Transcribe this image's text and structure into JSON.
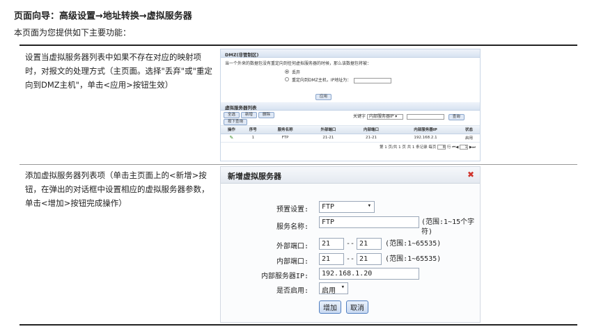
{
  "page": {
    "heading": "页面向导：高级设置→地址转换→虚拟服务器",
    "subheading": "本页面为您提供如下主要功能："
  },
  "rows": [
    {
      "description": "设置当虚拟服务器列表中如果不存在对应的映射项时，对报文的处理方式（主页面。选择\"丢弃\"或\"重定向到DMZ主机\"，单击<应用>按钮生效）"
    },
    {
      "description": "添加虚拟服务器列表项（单击主页面上的<新增>按钮，在弹出的对话框中设置相应的虚拟服务器参数，单击<增加>按钮完成操作）"
    }
  ],
  "dmz_panel": {
    "title": "DMZ(非管制区)",
    "question": "当一个外来的数据包没有重定向到任何虚拟服务器的时候，那么该数据包将被：",
    "option_drop": "丢弃",
    "option_redirect": "重定向到DMZ主机，IP地址为：",
    "apply_label": "应用"
  },
  "vs_list": {
    "title": "虚拟服务器列表",
    "btn_select_all": "全选",
    "btn_add": "新增",
    "btn_delete": "删除",
    "btn_filter": "按下查询",
    "keyword_label": "关键字",
    "keyword_select": "内部服务器IP",
    "search_label": "查询",
    "columns": [
      "操作",
      "序号",
      "服务名称",
      "外部端口",
      "内部端口",
      "内部服务器IP",
      "状态"
    ],
    "row": [
      "1",
      "FTP",
      "21-21",
      "21-21",
      "192.168.2.1",
      "启用"
    ],
    "pager": "第 1 页/共 1 页 共 1 条记录 每页",
    "per_page": "8",
    "pager_mid": "行",
    "page_num": "1"
  },
  "dialog": {
    "title": "新增虚拟服务器",
    "preset_label": "预置设置:",
    "preset_value": "FTP",
    "name_label": "服务名称:",
    "name_value": "FTP",
    "name_range": "(范围:1~15个字符)",
    "ext_port_label": "外部端口:",
    "ext_port_from": "21",
    "ext_port_to": "21",
    "int_port_label": "内部端口:",
    "int_port_from": "21",
    "int_port_to": "21",
    "port_range": "(范围:1~65535)",
    "port_sep": "--",
    "ip_label": "内部服务器IP:",
    "ip_value": "192.168.1.20",
    "enable_label": "是否启用:",
    "enable_value": "启用",
    "add_label": "增加",
    "cancel_label": "取消"
  }
}
